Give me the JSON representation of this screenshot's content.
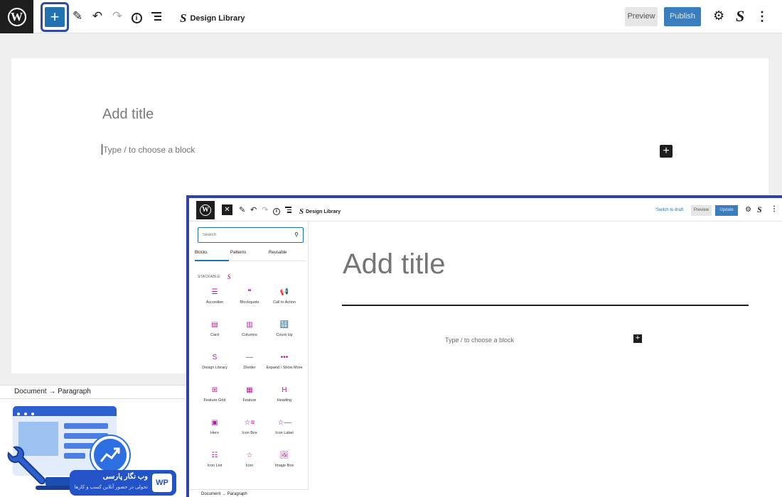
{
  "outer": {
    "toolbar": {
      "logo_glyph": "W",
      "inserter_glyph": "+",
      "edit_glyph": "✎",
      "undo_glyph": "↶",
      "redo_glyph": "↷",
      "info_glyph": "i",
      "stack_glyph": "S",
      "title": "Design Library",
      "preview_label": "Preview",
      "publish_label": "Publish",
      "settings_glyph": "⚙",
      "more_glyph": "⋮"
    },
    "editor": {
      "title_placeholder": "Add title",
      "paragraph_placeholder": "Type / to choose a block",
      "add_block_glyph": "+"
    },
    "breadcrumb": "Document → Paragraph"
  },
  "promo": {
    "line1": "وب نگار پارسی",
    "line2": "تحولی در حضور آنلاین کسب و کارها",
    "logo": "WP"
  },
  "inner": {
    "toolbar": {
      "logo_glyph": "W",
      "close_glyph": "✕",
      "edit_glyph": "✎",
      "undo_glyph": "↶",
      "redo_glyph": "↷",
      "info_glyph": "i",
      "stack_glyph": "S",
      "title": "Design Library",
      "switch_to_draft": "Switch to draft",
      "preview_label": "Preview",
      "update_label": "Update",
      "settings_glyph": "⚙",
      "more_glyph": "⋮"
    },
    "inserter": {
      "search_placeholder": "Search",
      "search_glyph": "⚲",
      "tabs": [
        "Blocks",
        "Patterns",
        "Reusable"
      ],
      "category": "STACKABLE",
      "category_glyph": "S",
      "blocks": [
        {
          "label": "Accordion",
          "icon": "☰"
        },
        {
          "label": "Blockquote",
          "icon": "❝"
        },
        {
          "label": "Call to Action",
          "icon": "📢"
        },
        {
          "label": "Card",
          "icon": "▤"
        },
        {
          "label": "Columns",
          "icon": "▥"
        },
        {
          "label": "Count Up",
          "icon": "🔢"
        },
        {
          "label": "Design Library",
          "icon": "S"
        },
        {
          "label": "Divider",
          "icon": "—"
        },
        {
          "label": "Expand / Show More",
          "icon": "•••"
        },
        {
          "label": "Feature Grid",
          "icon": "⊞"
        },
        {
          "label": "Feature",
          "icon": "▦"
        },
        {
          "label": "Heading",
          "icon": "H"
        },
        {
          "label": "Hero",
          "icon": "▣"
        },
        {
          "label": "Icon Box",
          "icon": "☆≡"
        },
        {
          "label": "Icon Label",
          "icon": "☆—"
        },
        {
          "label": "Icon List",
          "icon": "☷"
        },
        {
          "label": "Icon",
          "icon": "☆"
        },
        {
          "label": "Image Box",
          "icon": "🖼"
        }
      ],
      "breadcrumb": "Document → Paragraph"
    },
    "editor": {
      "title_placeholder": "Add title",
      "paragraph_placeholder": "Type / to choose a block",
      "add_block_glyph": "+"
    }
  },
  "colors": {
    "accent": "#2271b1",
    "highlight_border": "#2f43a8",
    "stackable_pink": "#b5199c"
  }
}
